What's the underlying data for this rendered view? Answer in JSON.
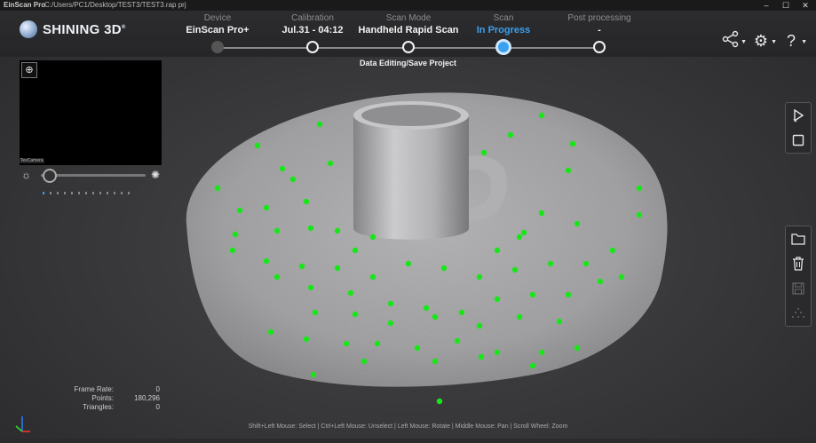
{
  "titlebar": {
    "app": "EinScan Pro",
    "path": "C:/Users/PC1/Desktop/TEST3/TEST3.rap  prj"
  },
  "brand": {
    "name": "SHINING 3D",
    "mark": "®"
  },
  "steps": [
    {
      "label": "Device",
      "value": "EinScan Pro+",
      "state": "done"
    },
    {
      "label": "Calibration",
      "value": "Jul.31 - 04:12",
      "state": "pending"
    },
    {
      "label": "Scan Mode",
      "value": "Handheld Rapid Scan",
      "state": "pending"
    },
    {
      "label": "Scan",
      "value": "In Progress",
      "state": "active"
    },
    {
      "label": "Post processing",
      "value": "-",
      "state": "pending"
    }
  ],
  "substatus": "Data Editing/Save Project",
  "preview": {
    "label": "TexCamera"
  },
  "stats": {
    "frame_rate": {
      "label": "Frame Rate:",
      "value": "0"
    },
    "points": {
      "label": "Points:",
      "value": "180,296"
    },
    "triangles": {
      "label": "Triangles:",
      "value": "0"
    }
  },
  "hint": "Shift+Left Mouse: Select | Ctrl+Left Mouse: Unselect | Left Mouse: Rotate | Middle Mouse: Pan | Scroll Wheel: Zoom",
  "icons": {
    "share": "share-icon",
    "settings": "gear-icon",
    "help": "help-icon",
    "zoom": "zoom-icon",
    "play": "play-icon",
    "stop": "stop-icon",
    "open": "folder-icon",
    "delete": "trash-icon",
    "save": "save-icon",
    "mesh": "mesh-icon"
  },
  "colors": {
    "accent": "#3ba0f0",
    "marker": "#19e619",
    "background": "#3a3a3d"
  }
}
